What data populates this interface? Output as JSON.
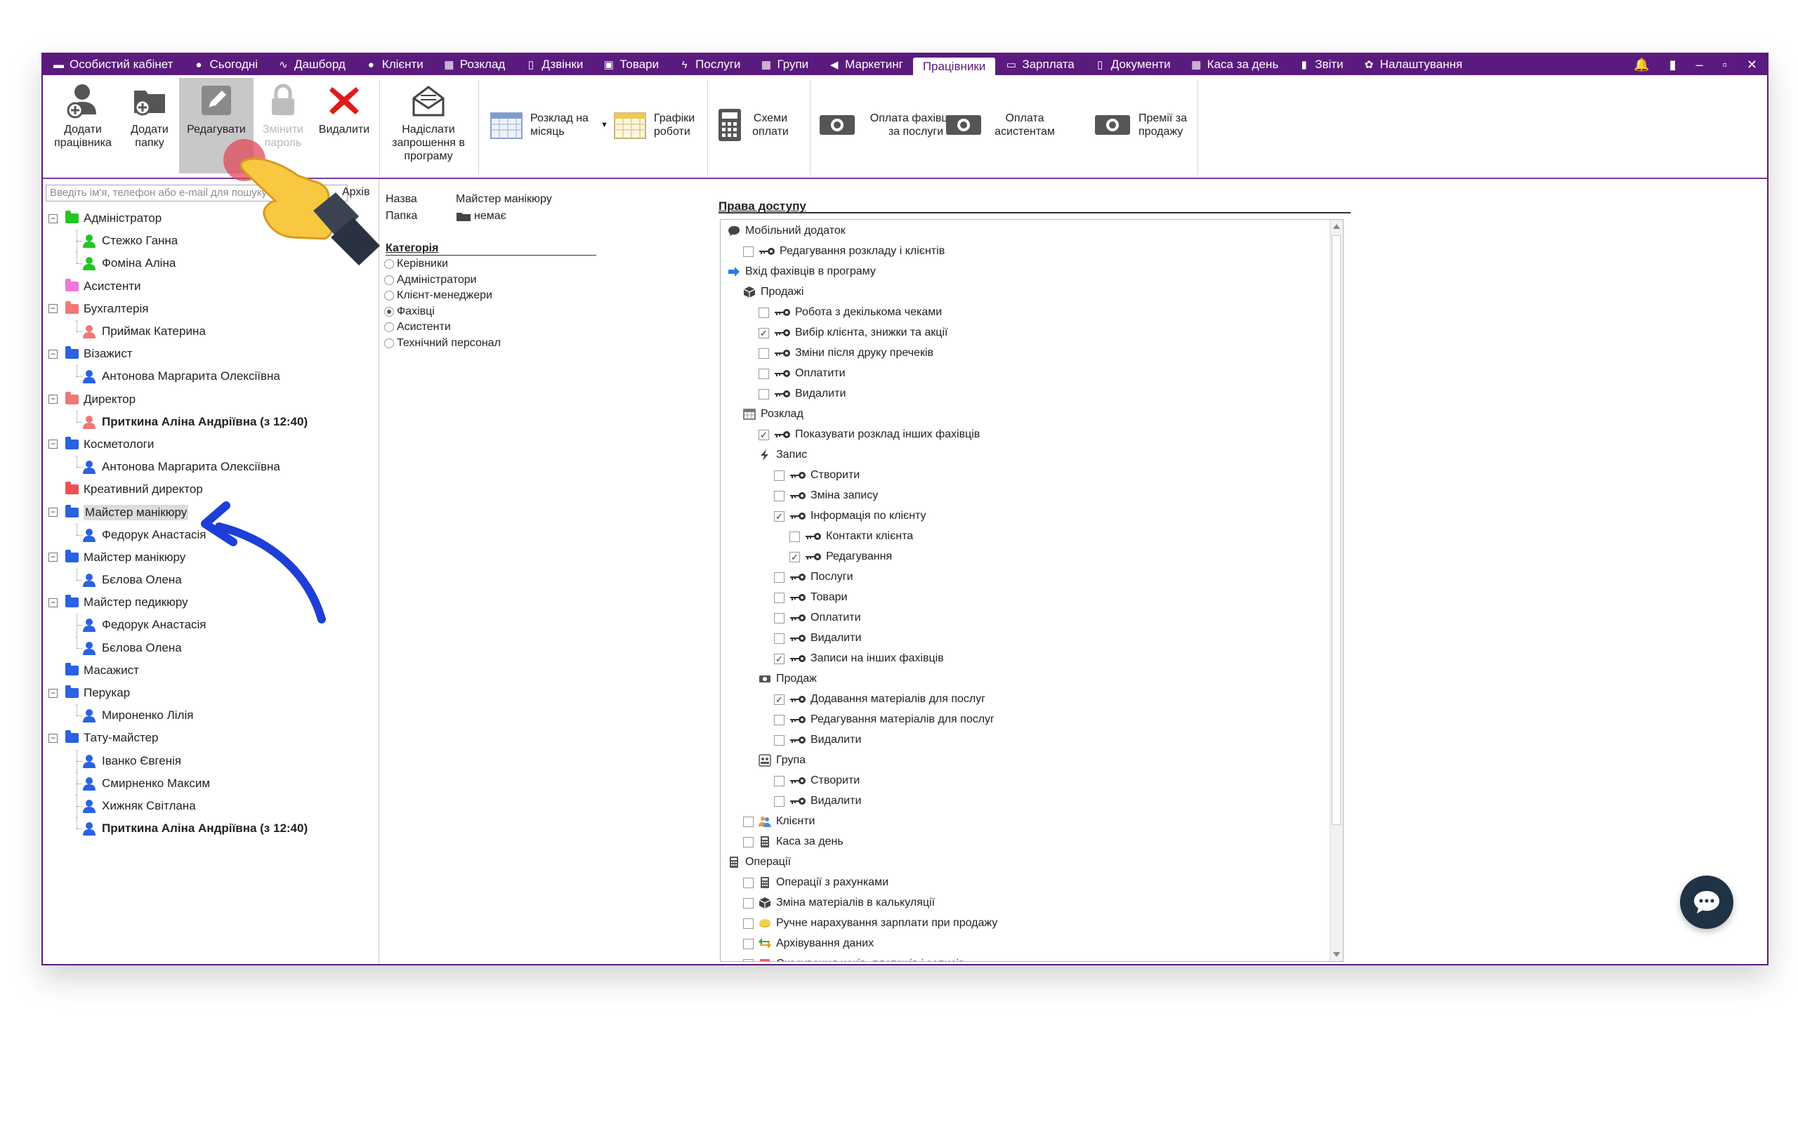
{
  "topnav": {
    "items": [
      {
        "label": "Особистий кабінет",
        "icon": "cabinet-icon"
      },
      {
        "label": "Сьогодні",
        "icon": "today-icon"
      },
      {
        "label": "Дашборд",
        "icon": "pulse-icon"
      },
      {
        "label": "Клієнти",
        "icon": "user-icon"
      },
      {
        "label": "Розклад",
        "icon": "schedule-icon"
      },
      {
        "label": "Дзвінки",
        "icon": "phone-icon"
      },
      {
        "label": "Товари",
        "icon": "box-icon"
      },
      {
        "label": "Послуги",
        "icon": "lightning-icon"
      },
      {
        "label": "Групи",
        "icon": "group-icon"
      },
      {
        "label": "Маркетинг",
        "icon": "megaphone-icon"
      },
      {
        "label": "Працівники",
        "icon": "",
        "active": true
      },
      {
        "label": "Зарплата",
        "icon": "money-icon"
      },
      {
        "label": "Документи",
        "icon": "document-icon"
      },
      {
        "label": "Каса за день",
        "icon": "calculator-icon"
      },
      {
        "label": "Звіти",
        "icon": "bar-chart-icon"
      },
      {
        "label": "Налаштування",
        "icon": "gear-icon"
      }
    ]
  },
  "ribbon": {
    "add_employee": "Додати працівника",
    "add_folder": "Додати папку",
    "edit": "Редагувати",
    "change_password": "Змінити пароль",
    "delete": "Видалити",
    "send_invite": "Надіслати запрошення в програму",
    "monthly_schedule": "Розклад на місяць",
    "work_graphs": "Графіки роботи",
    "pay_schemes": "Схеми оплати",
    "pay_specialists": "Оплата фахівцям за послуги",
    "pay_assistants": "Оплата асистентам",
    "sales_bonus": "Премії за продажу"
  },
  "left": {
    "search_placeholder": "Введіть ім'я, телефон або e-mail для пошуку",
    "archive_label": "Архів",
    "tree": [
      {
        "type": "folder",
        "label": "Адміністратор",
        "color": "#22c522",
        "exp": true
      },
      {
        "type": "person",
        "label": "Стежко Ганна",
        "color": "#22c522"
      },
      {
        "type": "person",
        "label": "Фоміна Аліна",
        "color": "#22c522",
        "last": true
      },
      {
        "type": "folder",
        "label": "Асистенти",
        "color": "#f078d8"
      },
      {
        "type": "folder",
        "label": "Бухгалтерія",
        "color": "#f07878",
        "exp": true
      },
      {
        "type": "person",
        "label": "Приймак Катерина",
        "color": "#f07878",
        "last": true
      },
      {
        "type": "folder",
        "label": "Візажист",
        "color": "#2a62e0",
        "exp": true
      },
      {
        "type": "person",
        "label": "Антонова Маргарита Олексіївна",
        "color": "#2a62e0",
        "last": true
      },
      {
        "type": "folder",
        "label": "Директор",
        "color": "#f07878",
        "exp": true
      },
      {
        "type": "person",
        "label": "Приткина Аліна Андріївна (з 12:40)",
        "color": "#f07878",
        "last": true,
        "bold": true
      },
      {
        "type": "folder",
        "label": "Косметологи",
        "color": "#2a62e0",
        "exp": true
      },
      {
        "type": "person",
        "label": "Антонова Маргарита Олексіївна",
        "color": "#2a62e0",
        "last": true
      },
      {
        "type": "folder",
        "label": "Креативний директор",
        "color": "#f05050"
      },
      {
        "type": "folder",
        "label": "Майстер манікюру",
        "color": "#2a62e0",
        "exp": true,
        "selected": true
      },
      {
        "type": "person",
        "label": "Федорук Анастасія",
        "color": "#2a62e0",
        "last": true
      },
      {
        "type": "folder",
        "label": "Майстер манікюру",
        "color": "#2a62e0",
        "exp": true
      },
      {
        "type": "person",
        "label": "Бєлова Олена",
        "color": "#2a62e0",
        "last": true
      },
      {
        "type": "folder",
        "label": "Майстер педикюру",
        "color": "#2a62e0",
        "exp": true
      },
      {
        "type": "person",
        "label": "Федорук Анастасія",
        "color": "#2a62e0"
      },
      {
        "type": "person",
        "label": "Бєлова Олена",
        "color": "#2a62e0",
        "last": true
      },
      {
        "type": "folder",
        "label": "Масажист",
        "color": "#2a62e0"
      },
      {
        "type": "folder",
        "label": "Перукар",
        "color": "#2a62e0",
        "exp": true
      },
      {
        "type": "person",
        "label": "Мироненко Лілія",
        "color": "#2a62e0",
        "last": true
      },
      {
        "type": "folder",
        "label": "Тату-майстер",
        "color": "#2a62e0",
        "exp": true
      },
      {
        "type": "person",
        "label": "Іванко Євгенія",
        "color": "#2a62e0"
      },
      {
        "type": "person",
        "label": "Смирненко Максим",
        "color": "#2a62e0"
      },
      {
        "type": "person",
        "label": "Хижняк Світлана",
        "color": "#2a62e0"
      },
      {
        "type": "person",
        "label": "Приткина Аліна Андріївна (з 12:40)",
        "color": "#2a62e0",
        "last": true,
        "bold": true
      }
    ]
  },
  "mid": {
    "name_label": "Назва",
    "name_value": "Майстер манікюру",
    "folder_label": "Папка",
    "folder_value": "немає",
    "category_label": "Категорія",
    "categories": [
      {
        "label": "Керівники",
        "checked": false
      },
      {
        "label": "Адміністратори",
        "checked": false
      },
      {
        "label": "Клієнт-менеджери",
        "checked": false
      },
      {
        "label": "Фахівці",
        "checked": true
      },
      {
        "label": "Асистенти",
        "checked": false
      },
      {
        "label": "Технічний персонал",
        "checked": false
      }
    ]
  },
  "rights": {
    "title": "Права доступу",
    "items": [
      {
        "level": 0,
        "label": "Мобільний додаток",
        "kind": "group",
        "icon": "chat-bubble-icon"
      },
      {
        "level": 1,
        "label": "Редагування розкладу і клієнтів",
        "kind": "check",
        "checked": false
      },
      {
        "level": 0,
        "label": "Вхід фахівців в програму",
        "kind": "group",
        "icon": "arrow-right-icon"
      },
      {
        "level": 1,
        "label": "Продажі",
        "kind": "group",
        "icon": "box-icon"
      },
      {
        "level": 2,
        "label": "Робота з декількома чеками",
        "kind": "check",
        "checked": false
      },
      {
        "level": 2,
        "label": "Вибір клієнта, знижки та акції",
        "kind": "check",
        "checked": true
      },
      {
        "level": 2,
        "label": "Зміни після друку пречеків",
        "kind": "check",
        "checked": false
      },
      {
        "level": 2,
        "label": "Оплатити",
        "kind": "check",
        "checked": false
      },
      {
        "level": 2,
        "label": "Видалити",
        "kind": "check",
        "checked": false
      },
      {
        "level": 1,
        "label": "Розклад",
        "kind": "group",
        "icon": "calendar-icon"
      },
      {
        "level": 2,
        "label": "Показувати розклад інших фахівців",
        "kind": "check",
        "checked": true
      },
      {
        "level": 2,
        "label": "Запис",
        "kind": "group",
        "icon": "lightning-icon"
      },
      {
        "level": 3,
        "label": "Створити",
        "kind": "check",
        "checked": false
      },
      {
        "level": 3,
        "label": "Зміна запису",
        "kind": "check",
        "checked": false
      },
      {
        "level": 3,
        "label": "Інформація по клієнту",
        "kind": "check",
        "checked": true
      },
      {
        "level": 4,
        "label": "Контакти клієнта",
        "kind": "check",
        "checked": false
      },
      {
        "level": 4,
        "label": "Редагування",
        "kind": "check",
        "checked": true
      },
      {
        "level": 3,
        "label": "Послуги",
        "kind": "check",
        "checked": false
      },
      {
        "level": 3,
        "label": "Товари",
        "kind": "check",
        "checked": false
      },
      {
        "level": 3,
        "label": "Оплатити",
        "kind": "check",
        "checked": false
      },
      {
        "level": 3,
        "label": "Видалити",
        "kind": "check",
        "checked": false
      },
      {
        "level": 3,
        "label": "Записи на інших фахівців",
        "kind": "check",
        "checked": true
      },
      {
        "level": 2,
        "label": "Продаж",
        "kind": "group",
        "icon": "money-icon"
      },
      {
        "level": 3,
        "label": "Додавання матеріалів для послуг",
        "kind": "check",
        "checked": true
      },
      {
        "level": 3,
        "label": "Редагування матеріалів для послуг",
        "kind": "check",
        "checked": false
      },
      {
        "level": 3,
        "label": "Видалити",
        "kind": "check",
        "checked": false
      },
      {
        "level": 2,
        "label": "Група",
        "kind": "group",
        "icon": "group-icon"
      },
      {
        "level": 3,
        "label": "Створити",
        "kind": "check",
        "checked": false
      },
      {
        "level": 3,
        "label": "Видалити",
        "kind": "check",
        "checked": false
      },
      {
        "level": 1,
        "label": "Клієнти",
        "kind": "check-icon",
        "checked": false,
        "icon": "clients-icon"
      },
      {
        "level": 1,
        "label": "Каса за день",
        "kind": "check-icon",
        "checked": false,
        "icon": "calculator-icon"
      },
      {
        "level": 0,
        "label": "Операції",
        "kind": "group",
        "icon": "calculator-icon"
      },
      {
        "level": 1,
        "label": "Операції з рахунками",
        "kind": "check-icon",
        "checked": false,
        "icon": "calculator-icon"
      },
      {
        "level": 1,
        "label": "Зміна матеріалів в калькуляції",
        "kind": "check-icon",
        "checked": false,
        "icon": "box-icon"
      },
      {
        "level": 1,
        "label": "Ручне нарахування зарплати при продажу",
        "kind": "check-icon",
        "checked": false,
        "icon": "coins-icon"
      },
      {
        "level": 1,
        "label": "Архівування даних",
        "kind": "check-icon",
        "checked": false,
        "icon": "archive-arrow-icon"
      },
      {
        "level": 1,
        "label": "Скасування чеків, платежів і записів",
        "kind": "check-icon",
        "checked": false,
        "icon": "trash-icon"
      }
    ]
  },
  "colors": {
    "nav": "#5b1b7e",
    "accent_blue": "#2a62e0",
    "chat": "#1f3345"
  }
}
